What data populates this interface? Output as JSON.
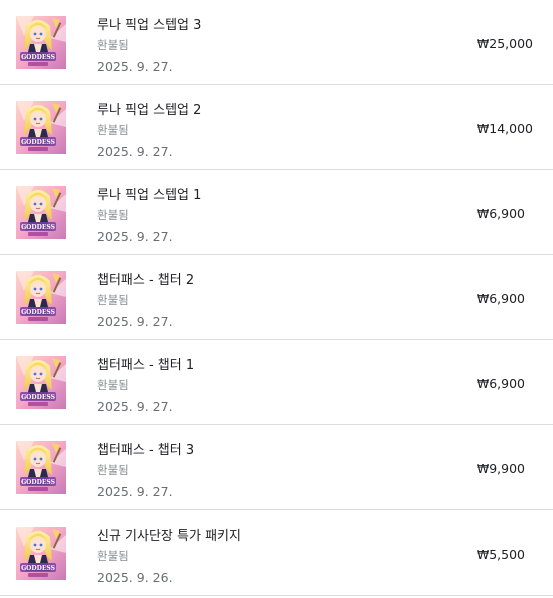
{
  "theme": {
    "divider_color": "#dadce0",
    "title_color": "#202124",
    "status_color": "#8a8d91",
    "date_color": "#6a6d72"
  },
  "purchases": [
    {
      "title": "루나 픽업 스텝업 3",
      "status": "환불됨",
      "date": "2025. 9. 27.",
      "price": "₩25,000",
      "icon": "game-thumbnail-icon"
    },
    {
      "title": "루나 픽업 스텝업 2",
      "status": "환불됨",
      "date": "2025. 9. 27.",
      "price": "₩14,000",
      "icon": "game-thumbnail-icon"
    },
    {
      "title": "루나 픽업 스텝업 1",
      "status": "환불됨",
      "date": "2025. 9. 27.",
      "price": "₩6,900",
      "icon": "game-thumbnail-icon"
    },
    {
      "title": "챕터패스 - 챕터 2",
      "status": "환불됨",
      "date": "2025. 9. 27.",
      "price": "₩6,900",
      "icon": "game-thumbnail-icon"
    },
    {
      "title": "챕터패스 - 챕터 1",
      "status": "환불됨",
      "date": "2025. 9. 27.",
      "price": "₩6,900",
      "icon": "game-thumbnail-icon"
    },
    {
      "title": "챕터패스 - 챕터 3",
      "status": "환불됨",
      "date": "2025. 9. 27.",
      "price": "₩9,900",
      "icon": "game-thumbnail-icon"
    },
    {
      "title": "신규 기사단장 특가 패키지",
      "status": "환불됨",
      "date": "2025. 9. 26.",
      "price": "₩5,500",
      "icon": "game-thumbnail-icon"
    }
  ]
}
